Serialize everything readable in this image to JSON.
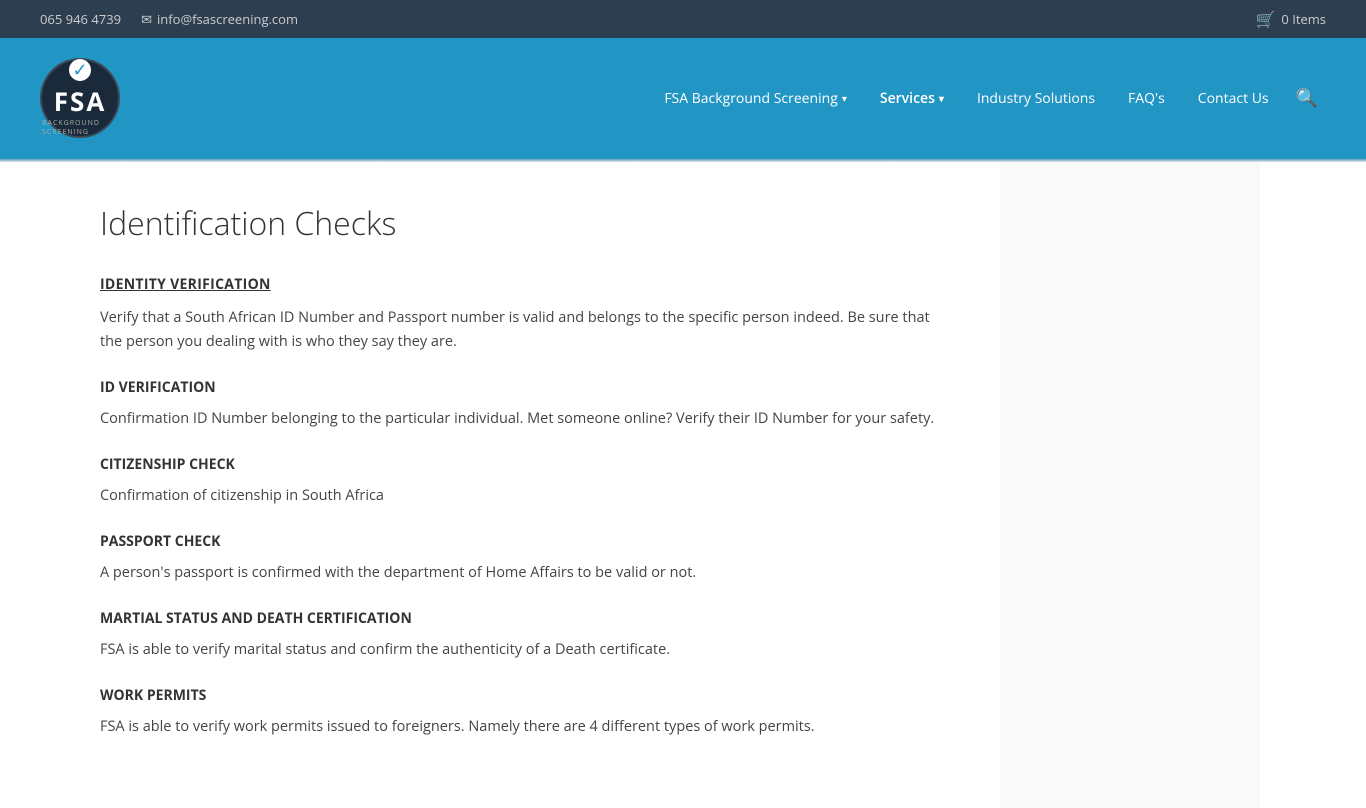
{
  "topbar": {
    "phone": "065 946 4739",
    "email": "info@fsascreening.com",
    "cart_label": "0 Items"
  },
  "header": {
    "logo_text": "FSA",
    "logo_tagline": "Background Screening",
    "nav": [
      {
        "id": "fsa-bg",
        "label": "FSA Background Screening",
        "has_arrow": true
      },
      {
        "id": "services",
        "label": "Services",
        "has_arrow": true
      },
      {
        "id": "industry",
        "label": "Industry Solutions",
        "has_arrow": false
      },
      {
        "id": "faqs",
        "label": "FAQ's",
        "has_arrow": false
      },
      {
        "id": "contact",
        "label": "Contact Us",
        "has_arrow": false
      }
    ]
  },
  "page": {
    "title": "Identification Checks",
    "sections": [
      {
        "heading": "IDENTITY VERIFICATION",
        "heading_style": "underline",
        "body": "Verify that a South African ID Number and Passport number is valid and belongs to the specific person indeed. Be sure that the person you dealing with is who they say they are."
      },
      {
        "heading": "ID VERIFICATION",
        "heading_style": "bold",
        "body": "Confirmation ID Number belonging to the particular individual. Met someone online? Verify their ID Number for your safety."
      },
      {
        "heading": "CITIZENSHIP CHECK",
        "heading_style": "bold",
        "body": "Confirmation of citizenship in South Africa"
      },
      {
        "heading": "PASSPORT CHECK",
        "heading_style": "bold",
        "body": "A person's passport is confirmed with the department of Home Affairs to be valid or not."
      },
      {
        "heading": "MARTIAL STATUS AND DEATH CERTIFICATION",
        "heading_style": "bold",
        "body": "FSA is able to verify marital status and confirm the authenticity of a Death certificate."
      },
      {
        "heading": "WORK PERMITS",
        "heading_style": "bold",
        "body": "FSA is able to verify work permits issued to foreigners. Namely there are 4 different types of work permits."
      }
    ]
  }
}
